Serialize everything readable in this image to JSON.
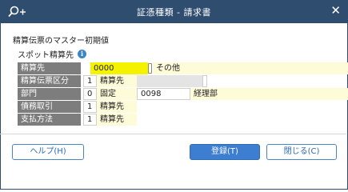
{
  "window": {
    "title": "証憑種類 - 請求書",
    "close_glyph": "✕",
    "icon": "search-plus-icon"
  },
  "section_title": "精算伝票のマスター初期値",
  "sub_title": "スポット精算先",
  "info_glyph": "i",
  "rows": {
    "r0": {
      "label": "精算先",
      "code": "0000",
      "name": "その他"
    },
    "r1": {
      "label": "精算伝票区分",
      "num": "1",
      "text": "精算先"
    },
    "r2": {
      "label": "部門",
      "num": "0",
      "mode": "固定",
      "code": "0098",
      "name": "経理部"
    },
    "r3": {
      "label": "債務取引",
      "num": "1",
      "text": "精算先"
    },
    "r4": {
      "label": "支払方法",
      "num": "1",
      "text": "精算先"
    }
  },
  "buttons": {
    "help": "ヘルプ(H)",
    "save": "登録(T)",
    "close": "閉じる(C)"
  },
  "colors": {
    "titlebar": "#2f4d6e",
    "primary": "#3d7ed1",
    "label_bg": "#7d7d7d",
    "highlight": "#f5f200"
  }
}
